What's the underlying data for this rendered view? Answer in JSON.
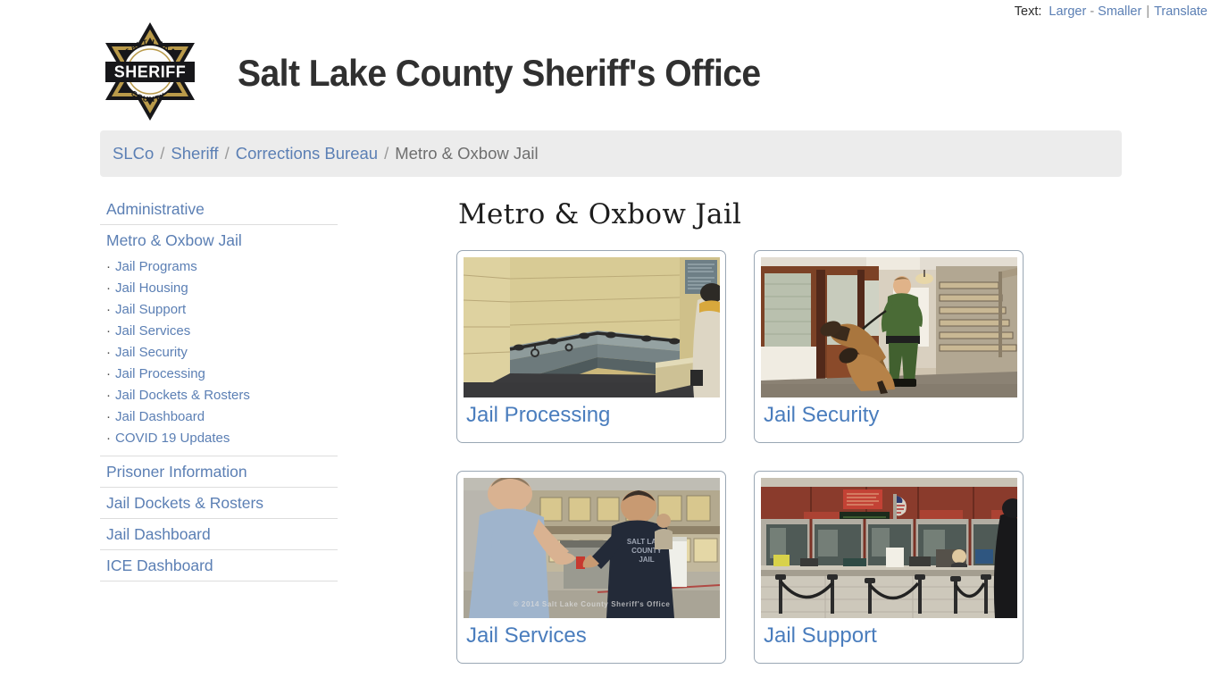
{
  "topbar": {
    "text_label": "Text:",
    "larger": "Larger",
    "dash": "-",
    "smaller": "Smaller",
    "pipe": "|",
    "translate": "Translate",
    "link_color": "#5b7fb4"
  },
  "header": {
    "site_title": "Salt Lake County Sheriff's Office",
    "badge": {
      "top_arc_text": "SALT LAKE",
      "center_text": "SHERIFF",
      "bottom_arc_text": "COUNTY",
      "gold_color": "#b99a4a",
      "dark_color": "#17171a"
    }
  },
  "breadcrumb": {
    "items": [
      {
        "label": "SLCo",
        "current": false
      },
      {
        "label": "Sheriff",
        "current": false
      },
      {
        "label": "Corrections Bureau",
        "current": false
      },
      {
        "label": "Metro & Oxbow Jail",
        "current": true
      }
    ],
    "separator": "/",
    "background": "#ececec"
  },
  "sidebar": {
    "sections": [
      {
        "label": "Administrative",
        "children": []
      },
      {
        "label": "Metro & Oxbow Jail",
        "children": [
          "Jail Programs",
          "Jail Housing",
          "Jail Support",
          "Jail Services",
          "Jail Security",
          "Jail Processing",
          "Jail Dockets & Rosters",
          "Jail Dashboard",
          "COVID 19 Updates"
        ]
      },
      {
        "label": "Prisoner Information",
        "children": []
      },
      {
        "label": "Jail Dockets & Rosters",
        "children": []
      },
      {
        "label": "Jail Dashboard",
        "children": []
      },
      {
        "label": "ICE Dashboard",
        "children": []
      }
    ],
    "bullet": "·"
  },
  "main": {
    "page_title": "Metro & Oxbow Jail",
    "cards": [
      {
        "label": "Jail Processing",
        "image_name": "holding-cell-bench-photo",
        "watermark": ""
      },
      {
        "label": "Jail Security",
        "image_name": "k9-officer-hallway-photo",
        "watermark": ""
      },
      {
        "label": "Jail Services",
        "image_name": "inmate-property-exchange-photo",
        "watermark": "© 2014 Salt Lake County Sheriff's Office"
      },
      {
        "label": "Jail Support",
        "image_name": "jail-lobby-reception-desk-photo",
        "watermark": ""
      }
    ],
    "card_link_color": "#4a7dbd"
  }
}
